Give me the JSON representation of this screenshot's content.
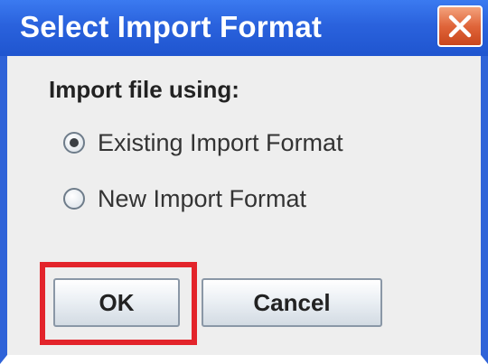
{
  "dialog": {
    "title": "Select Import Format",
    "section_label": "Import file using:",
    "options": [
      {
        "label": "Existing Import Format",
        "selected": true
      },
      {
        "label": "New Import Format",
        "selected": false
      }
    ],
    "buttons": {
      "ok": "OK",
      "cancel": "Cancel"
    }
  },
  "icons": {
    "close": "close-icon"
  },
  "colors": {
    "titlebar": "#2a62dd",
    "close_button": "#e0653a",
    "highlight": "#e3242b",
    "dialog_background": "#eeeeee"
  }
}
